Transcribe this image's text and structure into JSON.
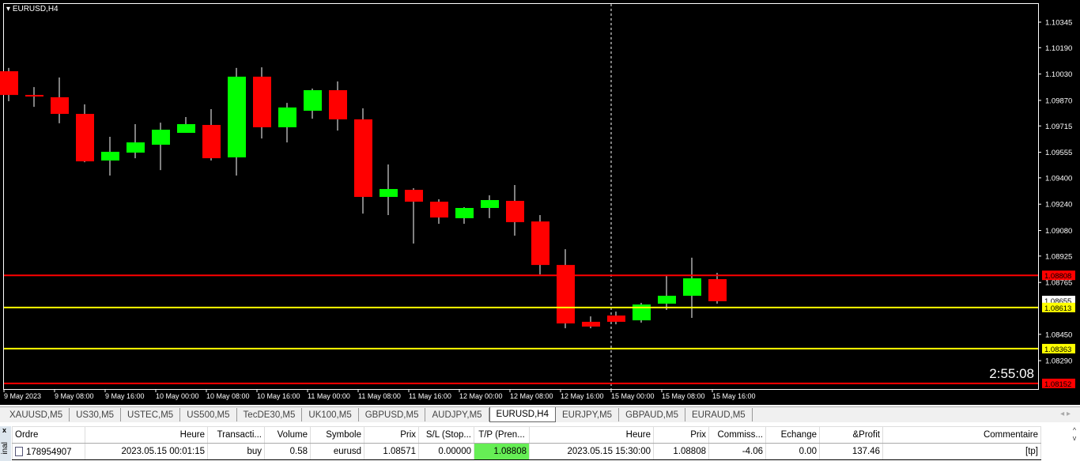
{
  "chart_title": "EURUSD,H4",
  "timer": "2:55:08",
  "chart_data": {
    "type": "candlestick",
    "symbol": "EURUSD",
    "timeframe": "H4",
    "ylim": [
      1.0813,
      1.104
    ],
    "price_ticks": [
      "1.10345",
      "1.10190",
      "1.10030",
      "1.09870",
      "1.09715",
      "1.09555",
      "1.09400",
      "1.09240",
      "1.09080",
      "1.08925",
      "1.08765",
      "1.08450",
      "1.08290"
    ],
    "time_labels": [
      "9 May 2023",
      "9 May 08:00",
      "9 May 16:00",
      "10 May 00:00",
      "10 May 08:00",
      "10 May 16:00",
      "11 May 00:00",
      "11 May 08:00",
      "11 May 16:00",
      "12 May 00:00",
      "12 May 08:00",
      "12 May 16:00",
      "15 May 00:00",
      "15 May 08:00",
      "15 May 16:00"
    ],
    "candles": [
      [
        1.10047,
        1.10067,
        1.09865,
        1.09903
      ],
      [
        1.09903,
        1.09951,
        1.09831,
        1.09894
      ],
      [
        1.09889,
        1.10009,
        1.09731,
        1.09788
      ],
      [
        1.09788,
        1.09846,
        1.09495,
        1.095
      ],
      [
        1.09505,
        1.09649,
        1.09414,
        1.09558
      ],
      [
        1.09553,
        1.09726,
        1.09519,
        1.09615
      ],
      [
        1.09601,
        1.09735,
        1.09447,
        1.09692
      ],
      [
        1.09673,
        1.09769,
        1.09673,
        1.09726
      ],
      [
        1.09721,
        1.09817,
        1.09505,
        1.09519
      ],
      [
        1.09524,
        1.10067,
        1.09414,
        1.10014
      ],
      [
        1.10014,
        1.10071,
        1.09639,
        1.09707
      ],
      [
        1.09707,
        1.09855,
        1.09615,
        1.09827
      ],
      [
        1.09807,
        1.09942,
        1.09759,
        1.09932
      ],
      [
        1.09932,
        1.09985,
        1.09687,
        1.09755
      ],
      [
        1.09755,
        1.09822,
        1.09183,
        1.09284
      ],
      [
        1.09284,
        1.09481,
        1.09174,
        1.09332
      ],
      [
        1.09327,
        1.09337,
        1.09001,
        1.09255
      ],
      [
        1.09255,
        1.0927,
        1.09121,
        1.09159
      ],
      [
        1.09155,
        1.09222,
        1.09121,
        1.09217
      ],
      [
        1.09217,
        1.09294,
        1.09155,
        1.09265
      ],
      [
        1.0926,
        1.09356,
        1.09049,
        1.09131
      ],
      [
        1.09135,
        1.09174,
        1.08814,
        1.08871
      ],
      [
        1.08871,
        1.08967,
        1.08487,
        1.08516
      ],
      [
        1.08526,
        1.08559,
        1.08487,
        1.08497
      ],
      [
        1.08564,
        1.08588,
        1.08511,
        1.08526
      ],
      [
        1.08535,
        1.08641,
        1.08521,
        1.08631
      ],
      [
        1.08636,
        1.08809,
        1.08598,
        1.08684
      ],
      [
        1.08684,
        1.08915,
        1.0855,
        1.0879
      ],
      [
        1.08785,
        1.08823,
        1.08636,
        1.08651
      ]
    ],
    "candle_format": [
      "open",
      "high",
      "low",
      "close"
    ],
    "levels": [
      {
        "price": "1.08808",
        "color": "#ff0000",
        "label_bg": "#ff0000"
      },
      {
        "price": "1.08613",
        "color": "#ffff00",
        "label_bg": "#ffff00"
      },
      {
        "price": "1.08363",
        "color": "#ffff00",
        "label_bg": "#ffff00"
      },
      {
        "price": "1.08152",
        "color": "#ff0000",
        "label_bg": "#ff0000"
      }
    ],
    "bid_label": "1.08655",
    "up_color": "#00ff00",
    "down_color": "#ff0000"
  },
  "tabs": [
    "XAUUSD,M5",
    "US30,M5",
    "USTEC,M5",
    "US500,M5",
    "TecDE30,M5",
    "UK100,M5",
    "GBPUSD,M5",
    "AUDJPY,M5",
    "EURUSD,H4",
    "EURJPY,M5",
    "GBPAUD,M5",
    "EURAUD,M5"
  ],
  "active_tab": "EURUSD,H4",
  "terminal": {
    "side_label": "inal",
    "close": "x",
    "headers": [
      "Ordre",
      "Heure",
      "Transacti...",
      "Volume",
      "Symbole",
      "Prix",
      "S/L (Stop...",
      "T/P (Pren...",
      "Heure",
      "Prix",
      "Commiss...",
      "Echange",
      "&Profit",
      "Commentaire"
    ],
    "row": [
      "178954907",
      "2023.05.15 00:01:15",
      "buy",
      "0.58",
      "eurusd",
      "1.08571",
      "0.00000",
      "1.08808",
      "2023.05.15 15:30:00",
      "1.08808",
      "-4.06",
      "0.00",
      "137.46",
      "[tp]"
    ]
  }
}
